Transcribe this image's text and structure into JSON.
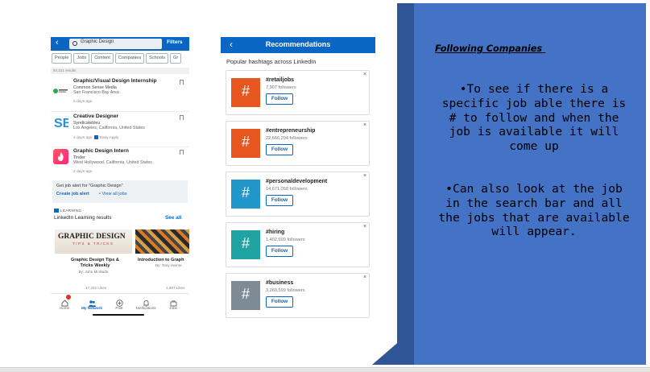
{
  "phone_search": {
    "search_value": "Graphic Design",
    "filters_label": "Filters",
    "chips": [
      "People",
      "Jobs",
      "Content",
      "Companies",
      "Schools",
      "Gr"
    ],
    "results_count": "60,221 results",
    "jobs": [
      {
        "title": "Graphic/Visual Design Internship",
        "company": "Common Sense Media",
        "location": "San Francisco Bay Area",
        "time": "5 days ago"
      },
      {
        "title": "Creative Designer",
        "company": "Syndicatebleu",
        "location": "Los Angeles, California, United States",
        "time": "4 days ago",
        "badge": "Easy Apply"
      },
      {
        "title": "Graphic Design Intern",
        "company": "Tinder",
        "location": "West Hollywood, California, United States",
        "time": "2 days ago"
      }
    ],
    "job_alert": {
      "text": "Get job alert for \"Graphic Design\"",
      "create": "Create job alert",
      "separator": "•",
      "view_all": "View all jobs"
    },
    "learning": {
      "tag": "LEARNING",
      "title": "LinkedIn Learning results",
      "see_all": "See all"
    },
    "courses": [
      {
        "thumb_head": "GRAPHIC DESIGN",
        "thumb_sub": "TIPS & TRICKS",
        "title_line1": "Graphic Design Tips &",
        "title_line2": "Tricks Weekly",
        "author": "By: John McWade",
        "likes": "17,262 Likes"
      },
      {
        "title_line1": "Introduction to Graph",
        "author": "By: Tony Harme",
        "likes": "1,987 Likes"
      }
    ],
    "nav": [
      "Home",
      "My Network",
      "Post",
      "Notifications",
      "Jobs"
    ]
  },
  "phone_recs": {
    "title": "Recommendations",
    "subtitle": "Popular hashtags across LinkedIn",
    "follow_label": "Follow",
    "close_glyph": "×",
    "hash_glyph": "#",
    "items": [
      {
        "name": "#retailjobs",
        "followers": "7,907 followers",
        "color": "#e8561f"
      },
      {
        "name": "#entrepreneurship",
        "followers": "22,666,294 followers",
        "color": "#e8561f"
      },
      {
        "name": "#personaldevelopment",
        "followers": "14,671,058 followers",
        "color": "#2196c9"
      },
      {
        "name": "#hiring",
        "followers": "1,402,699 followers",
        "color": "#1fa3a3"
      },
      {
        "name": "#business",
        "followers": "3,269,599 followers",
        "color": "#7d8b96"
      }
    ]
  },
  "panel": {
    "heading": "Following Companies ",
    "bullet1": "•To see if there is a specific job able there is # to follow and when the job is available it will come up",
    "bullet2": "•Can also look at the job in the search bar and all the jobs that are available will appear.",
    "colors": {
      "panel": "#4472c4",
      "accent_dark": "#2f5597"
    }
  }
}
